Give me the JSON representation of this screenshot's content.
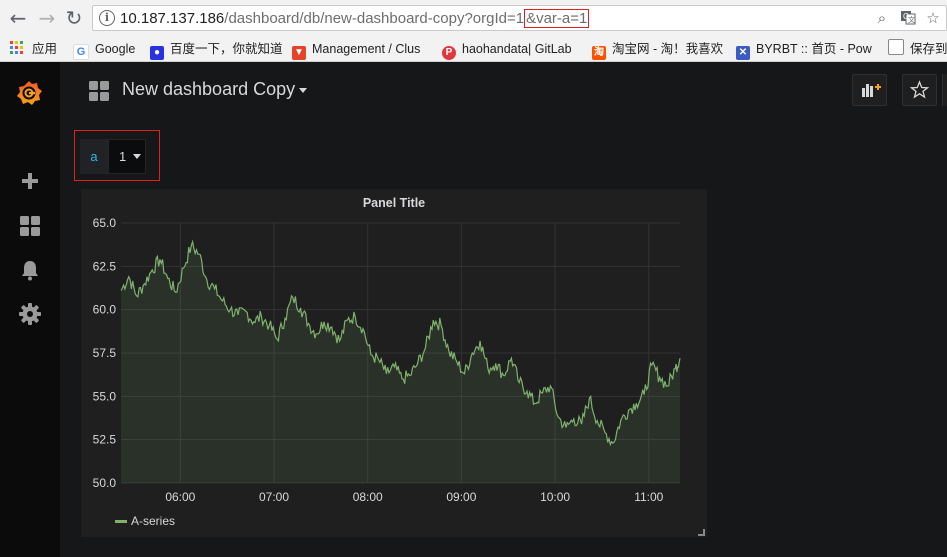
{
  "browser": {
    "url_host": "10.187.137.186",
    "url_path": "/dashboard/db/new-dashboard-copy?orgId=1",
    "url_highlight": "&var-a=1",
    "bookmarks": [
      {
        "label": "应用",
        "icon": "apps-grid-icon",
        "color": "#e94235"
      },
      {
        "label": "Google",
        "icon": "google-icon",
        "color": "#4285f4"
      },
      {
        "label": "百度一下，你就知道",
        "icon": "baidu-paw-icon",
        "color": "#2932e1"
      },
      {
        "label": "Management / Clus",
        "icon": "gitlab-fox-icon",
        "color": "#e24329"
      },
      {
        "label": "haohandata| GitLab",
        "icon": "p-badge-icon",
        "color": "#e0383e"
      },
      {
        "label": "淘宝网 - 淘！我喜欢",
        "icon": "taobao-icon",
        "color": "#ff5000"
      },
      {
        "label": "BYRBT :: 首页 - Pow",
        "icon": "byr-butterfly-icon",
        "color": "#3a5bbf"
      },
      {
        "label": "保存到",
        "icon": "page-icon",
        "color": "#888888"
      }
    ]
  },
  "sidebar": {
    "items": [
      {
        "icon": "grafana-logo-icon"
      },
      {
        "icon": "plus-icon"
      },
      {
        "icon": "dashboards-grid-icon"
      },
      {
        "icon": "bell-icon"
      },
      {
        "icon": "gear-icon"
      }
    ]
  },
  "dashboard": {
    "title": "New dashboard Copy",
    "variable": {
      "label": "a",
      "value": "1"
    }
  },
  "panel": {
    "title": "Panel Title",
    "legend": "A-series"
  },
  "chart_data": {
    "type": "area",
    "title": "Panel Title",
    "xlabel": "",
    "ylabel": "",
    "ylim": [
      50.0,
      65.0
    ],
    "y_ticks": [
      "65.0",
      "62.5",
      "60.0",
      "57.5",
      "55.0",
      "52.5",
      "50.0"
    ],
    "x_ticks": [
      "06:00",
      "07:00",
      "08:00",
      "09:00",
      "10:00",
      "11:00"
    ],
    "x_range": [
      "05:22",
      "11:20"
    ],
    "grid": true,
    "legend_position": "bottom-left",
    "series": [
      {
        "name": "A-series",
        "color": "#7eb26d",
        "x": [
          "05:22",
          "05:27",
          "05:32",
          "05:37",
          "05:42",
          "05:47",
          "05:52",
          "05:57",
          "06:02",
          "06:07",
          "06:12",
          "06:17",
          "06:22",
          "06:27",
          "06:32",
          "06:37",
          "06:42",
          "06:47",
          "06:52",
          "06:57",
          "07:02",
          "07:07",
          "07:12",
          "07:17",
          "07:22",
          "07:27",
          "07:32",
          "07:37",
          "07:42",
          "07:47",
          "07:52",
          "07:57",
          "08:02",
          "08:07",
          "08:12",
          "08:17",
          "08:22",
          "08:27",
          "08:32",
          "08:37",
          "08:42",
          "08:47",
          "08:52",
          "08:57",
          "09:02",
          "09:07",
          "09:12",
          "09:17",
          "09:22",
          "09:27",
          "09:32",
          "09:37",
          "09:42",
          "09:47",
          "09:52",
          "09:57",
          "10:02",
          "10:07",
          "10:12",
          "10:17",
          "10:22",
          "10:27",
          "10:32",
          "10:37",
          "10:42",
          "10:47",
          "10:52",
          "10:57",
          "11:02",
          "11:07",
          "11:12",
          "11:17",
          "11:20"
        ],
        "values": [
          61.1,
          61.9,
          60.8,
          61.5,
          62.3,
          62.9,
          61.8,
          61.0,
          62.4,
          63.7,
          63.2,
          61.7,
          61.2,
          60.5,
          60.0,
          59.7,
          59.9,
          59.3,
          59.6,
          59.1,
          58.3,
          59.5,
          60.7,
          60.1,
          59.2,
          58.6,
          59.3,
          59.0,
          58.2,
          59.4,
          59.6,
          58.9,
          57.4,
          57.1,
          56.3,
          56.7,
          56.0,
          56.2,
          56.9,
          57.8,
          59.4,
          59.1,
          57.6,
          57.0,
          56.3,
          57.5,
          58.2,
          56.6,
          56.9,
          56.2,
          57.2,
          55.8,
          55.3,
          54.6,
          55.2,
          55.6,
          53.8,
          53.2,
          53.7,
          53.4,
          54.9,
          53.6,
          52.9,
          52.3,
          53.6,
          54.2,
          54.6,
          55.1,
          56.8,
          56.1,
          55.6,
          56.6,
          57.2
        ]
      }
    ]
  }
}
